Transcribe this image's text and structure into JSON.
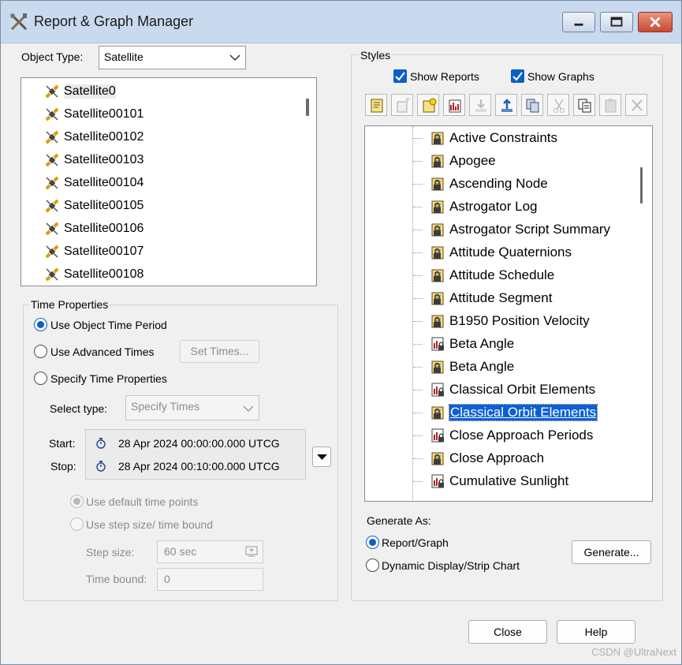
{
  "window": {
    "title": "Report & Graph Manager"
  },
  "object_type": {
    "label": "Object Type:",
    "value": "Satellite"
  },
  "objects": [
    {
      "name": "Satellite0"
    },
    {
      "name": "Satellite00101"
    },
    {
      "name": "Satellite00102"
    },
    {
      "name": "Satellite00103"
    },
    {
      "name": "Satellite00104"
    },
    {
      "name": "Satellite00105"
    },
    {
      "name": "Satellite00106"
    },
    {
      "name": "Satellite00107"
    },
    {
      "name": "Satellite00108"
    }
  ],
  "time_properties": {
    "title": "Time Properties",
    "use_object_time_period": "Use Object Time Period",
    "use_advanced_times": "Use Advanced Times",
    "set_times_button": "Set Times...",
    "specify_time_properties": "Specify Time Properties",
    "select_type_label": "Select type:",
    "select_type_value": "Specify Times",
    "start_label": "Start:",
    "start_value": "28 Apr 2024 00:00:00.000 UTCG",
    "stop_label": "Stop:",
    "stop_value": "28 Apr 2024 00:10:00.000 UTCG",
    "use_default_time_points": "Use default time points",
    "use_step_size": "Use step size/ time bound",
    "step_size_label": "Step size:",
    "step_size_value": "60 sec",
    "time_bound_label": "Time bound:",
    "time_bound_value": "0"
  },
  "styles": {
    "title": "Styles",
    "show_reports": "Show Reports",
    "show_graphs": "Show Graphs",
    "items": [
      {
        "name": "Active Constraints",
        "kind": "report"
      },
      {
        "name": "Apogee",
        "kind": "report"
      },
      {
        "name": "Ascending Node",
        "kind": "report"
      },
      {
        "name": "Astrogator Log",
        "kind": "report"
      },
      {
        "name": "Astrogator Script Summary",
        "kind": "report"
      },
      {
        "name": "Attitude Quaternions",
        "kind": "report"
      },
      {
        "name": "Attitude Schedule",
        "kind": "report"
      },
      {
        "name": "Attitude Segment",
        "kind": "report"
      },
      {
        "name": "B1950 Position Velocity",
        "kind": "report"
      },
      {
        "name": "Beta Angle",
        "kind": "graph"
      },
      {
        "name": "Beta Angle",
        "kind": "report"
      },
      {
        "name": "Classical Orbit Elements",
        "kind": "graph"
      },
      {
        "name": "Classical Orbit Elements",
        "kind": "report",
        "selected": true
      },
      {
        "name": "Close Approach Periods",
        "kind": "graph"
      },
      {
        "name": "Close Approach",
        "kind": "report"
      },
      {
        "name": "Cumulative Sunlight",
        "kind": "graph"
      }
    ]
  },
  "generate_as": {
    "title": "Generate As:",
    "report_graph": "Report/Graph",
    "dynamic_display": "Dynamic Display/Strip Chart",
    "generate_button": "Generate..."
  },
  "footer": {
    "close_button": "Close",
    "help_button": "Help"
  },
  "watermark": "CSDN @UltraNext"
}
